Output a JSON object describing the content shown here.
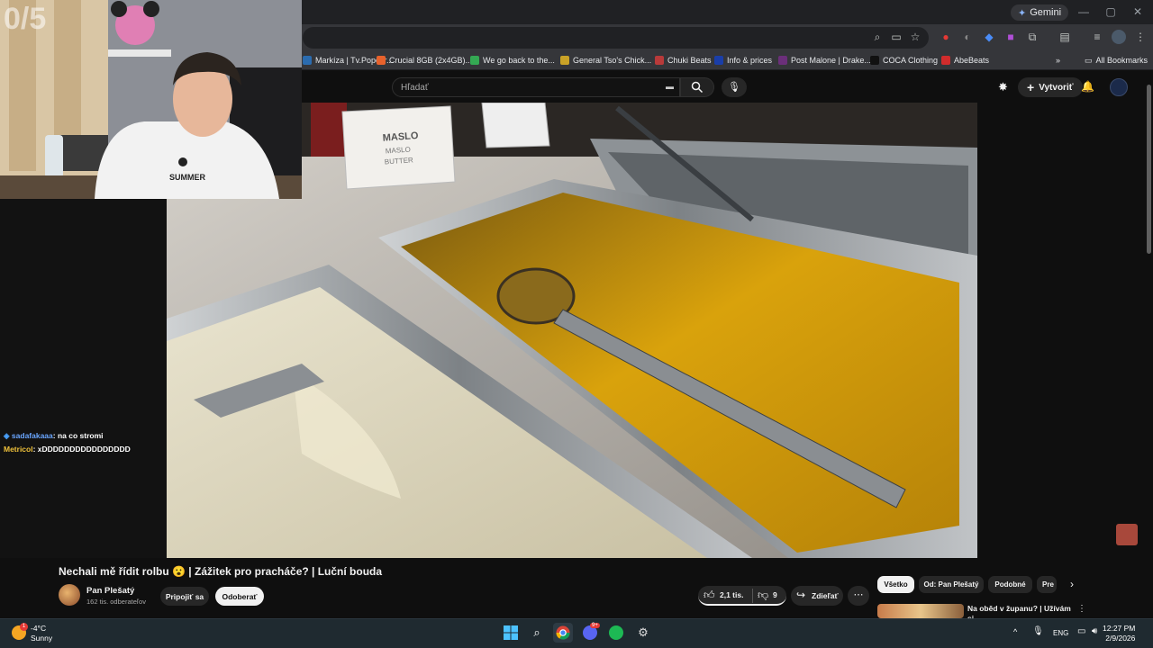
{
  "browser": {
    "gemini_label": "Gemini",
    "bookmarks": [
      {
        "label": "Markíza | Tv.Popcor...",
        "color": "#2b6cb0"
      },
      {
        "label": "Crucial 8GB (2x4GB)...",
        "color": "#e8622c"
      },
      {
        "label": "We go back to the...",
        "color": "#34a853"
      },
      {
        "label": "General Tso's Chick...",
        "color": "#c9a227"
      },
      {
        "label": "Chuki Beats",
        "color": "#b83a3a"
      },
      {
        "label": "Info & prices",
        "color": "#1a3ea8"
      },
      {
        "label": "Post Malone | Drake...",
        "color": "#6b2f7a"
      },
      {
        "label": "COCA Clothing",
        "color": "#111111"
      },
      {
        "label": "AbeBeats",
        "color": "#d12c2c"
      }
    ],
    "all_bookmarks": "All Bookmarks"
  },
  "youtube": {
    "search_placeholder": "Hľadať",
    "create_label": "Vytvoriť"
  },
  "stream": {
    "webcam_overlay_text": "0/5",
    "chat": [
      {
        "user": "sadafakaaa",
        "message": ": na co stromi",
        "user_color": "#6aa6ff"
      },
      {
        "user": "Metricol",
        "message": ": xDDDDDDDDDDDDDDDD",
        "user_color": "#f0c23b"
      }
    ]
  },
  "video": {
    "sign_text": [
      "MASLO",
      "MASLO",
      "BUTTER"
    ],
    "title": "Nechali mě řídit rolbu 😮 | Zážitek pro pracháče? | Luční bouda",
    "channel_name": "Pan Plešatý",
    "channel_subs": "162 tis. odberateľov",
    "join_label": "Pripojiť sa",
    "subscribe_label": "Odoberať",
    "likes": "2,1 tis.",
    "dislikes": "9",
    "share_label": "Zdieľať"
  },
  "sidebar": {
    "chips": [
      "Všetko",
      "Od: Pan Plešatý",
      "Podobné",
      "Pre"
    ],
    "recommendation_title": "Na oběd v županu? | Užívám si"
  },
  "taskbar": {
    "weather_temp": "-4°C",
    "weather_desc": "Sunny",
    "weather_badge": "1",
    "language": "ENG",
    "time": "12:27 PM",
    "date": "2/9/2026",
    "discord_badge": "9+"
  },
  "colors": {
    "accent_blue": "#3ea6ff",
    "brand_red": "#ff0000"
  }
}
